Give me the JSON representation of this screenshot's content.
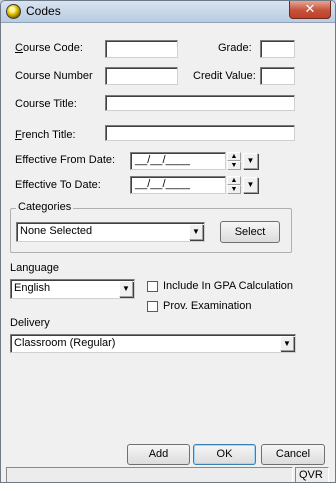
{
  "window": {
    "title": "Codes",
    "close_glyph": "✕"
  },
  "form": {
    "course_code_label": "Course Code:",
    "course_code_value": "",
    "grade_label": "Grade:",
    "grade_value": "",
    "course_number_label": "Course Number",
    "course_number_value": "",
    "credit_value_label": "Credit Value:",
    "credit_value_value": "",
    "course_title_label": "Course Title:",
    "course_title_value": "",
    "french_title_label": "French Title:",
    "french_title_value": "",
    "effective_from_label": "Effective From Date:",
    "effective_from_value": "__/__/____",
    "effective_to_label": "Effective To Date:",
    "effective_to_value": "__/__/____"
  },
  "categories": {
    "group_label": "Categories",
    "selected": "None Selected",
    "select_button": "Select"
  },
  "language": {
    "label": "Language",
    "selected": "English",
    "include_gpa_label": "Include In GPA Calculation",
    "include_gpa_checked": false,
    "prov_exam_label": "Prov. Examination",
    "prov_exam_checked": false
  },
  "delivery": {
    "label": "Delivery",
    "selected": "Classroom (Regular)"
  },
  "buttons": {
    "add": "Add",
    "ok": "OK",
    "cancel": "Cancel"
  },
  "status": {
    "pane_right": "QVR"
  },
  "icons": {
    "dropdown": "▼",
    "spin_up": "▲",
    "spin_down": "▼"
  }
}
